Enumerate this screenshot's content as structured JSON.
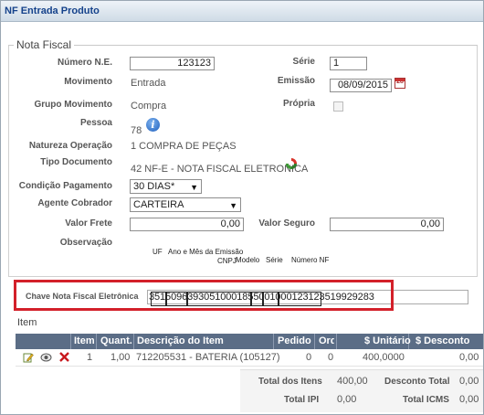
{
  "window": {
    "title": "NF Entrada Produto"
  },
  "section_title": "Nota Fiscal",
  "fields": {
    "numero_label": "Número N.E.",
    "numero_value": "123123",
    "serie_label": "Série",
    "serie_value": "1",
    "movimento_label": "Movimento",
    "movimento_value": "Entrada",
    "emissao_label": "Emissão",
    "emissao_value": "08/09/2015",
    "grupo_label": "Grupo Movimento",
    "grupo_value": "Compra",
    "propria_label": "Própria",
    "pessoa_label": "Pessoa",
    "pessoa_value": "78",
    "natureza_label": "Natureza Operação",
    "natureza_value": "1 COMPRA DE PEÇAS",
    "tipodoc_label": "Tipo Documento",
    "tipodoc_value": "42 NF-E - NOTA FISCAL ELETRONICA",
    "condpag_label": "Condição Pagamento",
    "condpag_value": "30 DIAS*",
    "agente_label": "Agente Cobrador",
    "agente_value": "CARTEIRA",
    "frete_label": "Valor Frete",
    "frete_value": "0,00",
    "seguro_label": "Valor Seguro",
    "seguro_value": "0,00",
    "obs_label": "Observação"
  },
  "key_legend": {
    "uf": "UF",
    "ano_mes": "Ano e Mês da Emissão",
    "cnpj": "CNPJ",
    "modelo": "Modelo",
    "serie": "Série",
    "numero": "Número NF"
  },
  "chave": {
    "label": "Chave Nota Fiscal Eletrônica",
    "value": "35150963930510001855001000123123519929283"
  },
  "items": {
    "title": "Item",
    "headers": [
      "Item",
      "Quant.",
      "Descrição do Item",
      "Pedido",
      "Ord",
      "$ Unitário",
      "$ Desconto"
    ],
    "rows": [
      [
        "1",
        "1,00",
        "712205531 - BATERIA (105127)",
        "0",
        "0",
        "400,0000",
        "0,00"
      ]
    ]
  },
  "totals": {
    "total_itens_label": "Total dos Itens",
    "total_itens_value": "400,00",
    "desconto_total_label": "Desconto Total",
    "desconto_total_value": "0,00",
    "total_ipi_label": "Total IPI",
    "total_ipi_value": "0,00",
    "total_icms_label": "Total ICMS",
    "total_icms_value": "0,00"
  },
  "colors": {
    "title_bar": "#cfdbe6",
    "grid_header": "#5b6d86",
    "highlight": "#d3202a"
  }
}
